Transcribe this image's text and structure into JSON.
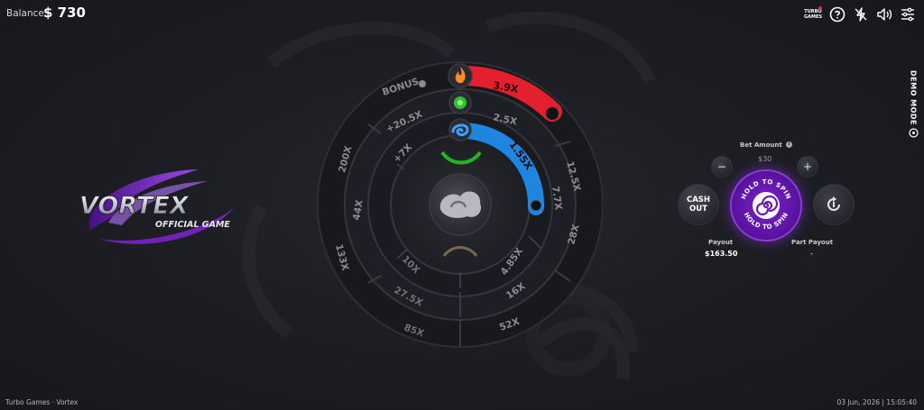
{
  "header": {
    "balance_label": "Balance:",
    "balance_value": "$ 730",
    "icons": [
      "turbo-games-logo",
      "help-icon",
      "lightning-off-icon",
      "sound-icon",
      "settings-icon"
    ],
    "turbo_logo_text": [
      "TURBO",
      "GAMES"
    ]
  },
  "demo_mode": {
    "label": "DEMO MODE"
  },
  "logo": {
    "title": "VORTEX",
    "subtitle": "OFFICIAL GAME"
  },
  "wheel": {
    "bonus_label": "BONUS",
    "outer_ring": [
      "3.9X",
      "12.5X",
      "28X",
      "52X",
      "85X",
      "133X",
      "200X"
    ],
    "middle_ring": [
      "+20.5X",
      "2.5X",
      "7.7X",
      "16X",
      "27.5X",
      "44X"
    ],
    "inner_ring": [
      "+7X",
      "1.55X",
      "4.85X",
      "10X"
    ],
    "colors": {
      "fire": "#e5202e",
      "water": "#1e86e0",
      "earth": "#1fb81e"
    },
    "elements": [
      "fire-icon",
      "earth-icon",
      "water-icon",
      "wind-icon"
    ]
  },
  "bet": {
    "label": "Bet Amount",
    "value": "$30",
    "minus": "−",
    "plus": "+"
  },
  "cashout": {
    "label_line1": "CASH",
    "label_line2": "OUT"
  },
  "spin": {
    "label": "HOLD TO SPIN"
  },
  "payout": {
    "label": "Payout",
    "value": "$163.50"
  },
  "part_payout": {
    "label": "Part Payout",
    "value": "-"
  },
  "footer": {
    "left": "Turbo Games · Vortex",
    "right": "03 Jun, 2026 | 15:05:40"
  },
  "accent_color": "#7a22c9"
}
